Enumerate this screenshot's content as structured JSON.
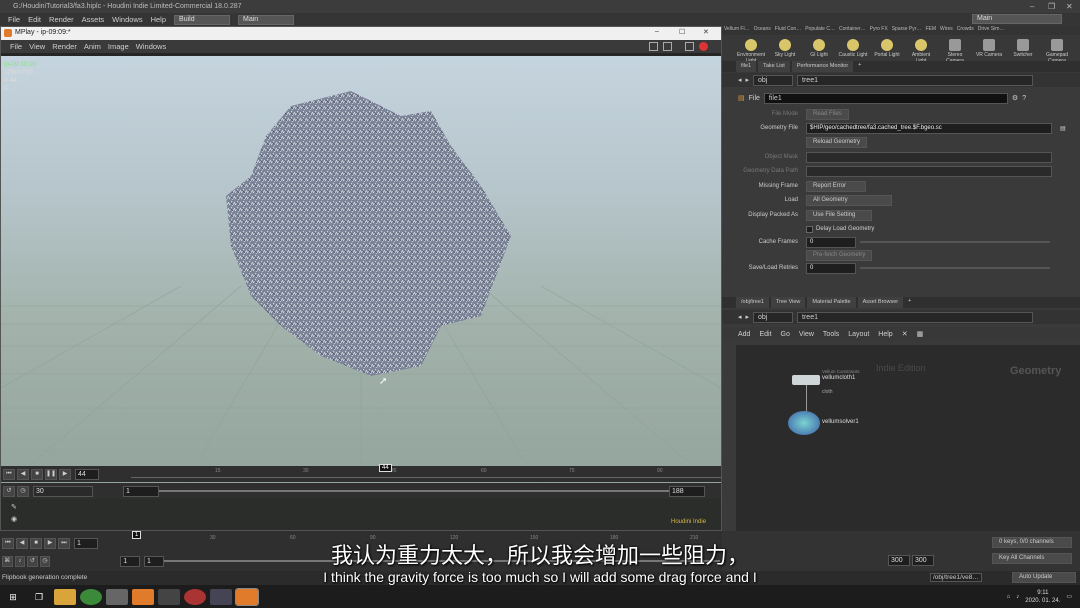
{
  "window_title": "G:/HoudiniTutorial3/fa3.hiplc - Houdini Indie Limited-Commercial 18.0.287",
  "app_menu": [
    "File",
    "Edit",
    "Render",
    "Assets",
    "Windows",
    "Help"
  ],
  "desktop_dropdown": "Build",
  "main_dropdown": "Main",
  "right_desktop": "Main",
  "mplay": {
    "title": "MPlay - ip-09:09:*",
    "menu": [
      "File",
      "View",
      "Render",
      "Anim",
      "Image",
      "Windows"
    ],
    "info": {
      "frame": "ip-09:10:20",
      "res": "1280x720",
      "fr": "fr 44",
      "c": "C"
    },
    "current_frame": "44",
    "start": "30",
    "range_start": "1",
    "range_end": "188",
    "ticks": [
      "15",
      "30",
      "45",
      "60",
      "75",
      "90"
    ],
    "marker": "44",
    "watermark": "Houdini Indie"
  },
  "shelf_tabs": [
    "Vellum Fl…",
    "Oceans",
    "Fluid Con…",
    "Populate C…",
    "Container…",
    "Pyro FX",
    "Sparse Pyr…",
    "FEM",
    "Wires",
    "Crowds",
    "Drive Sim…"
  ],
  "shelf_tools": [
    "Environment Light",
    "Sky Light",
    "GI Light",
    "Caustic Light",
    "Portal Light",
    "Ambient Light",
    "Stereo Camera",
    "VR Camera",
    "Switcher",
    "Gamepad Camera"
  ],
  "param_tabs": [
    "file1",
    "Take List",
    "Performance Monitor"
  ],
  "path": {
    "context": "obj",
    "node": "tree1"
  },
  "node_header": {
    "type": "File",
    "name": "file1"
  },
  "params": [
    {
      "label": "File Mode",
      "value": "Read Files",
      "dim": true
    },
    {
      "label": "Geometry File",
      "value": "$HIP/geo/cachedtree/fa3.cached_tree.$F.bgeo.sc"
    },
    {
      "label": "",
      "button": "Reload Geometry"
    },
    {
      "label": "Object Mask",
      "value": "",
      "dim": true
    },
    {
      "label": "Geometry Data Path",
      "value": "",
      "dim": true
    },
    {
      "label": "Missing Frame",
      "value": "Report Error"
    },
    {
      "label": "Load",
      "value": "All Geometry"
    },
    {
      "label": "Display Packed As",
      "value": "Use File Setting"
    },
    {
      "label": "",
      "check": "Delay Load Geometry"
    },
    {
      "label": "Cache Frames",
      "value": "0"
    },
    {
      "label": "",
      "button": "Pre-fetch Geometry"
    },
    {
      "label": "Save/Load Retries",
      "value": "0"
    }
  ],
  "net_tabs": [
    "/obj/tree1",
    "Tree View",
    "Material Palette",
    "Asset Browser"
  ],
  "net_menu": [
    "Add",
    "Edit",
    "Go",
    "View",
    "Tools",
    "Layout",
    "Help"
  ],
  "net_watermark": {
    "edition": "Indie Edition",
    "context": "Geometry"
  },
  "nodes": [
    {
      "name": "vellumcloth1",
      "sub": "Vellum Constraints",
      "flag": "cloth"
    },
    {
      "name": "vellumsolver1",
      "sub": "",
      "flag": ""
    }
  ],
  "main_timeline": {
    "ticks": [
      "1",
      "30",
      "60",
      "90",
      "120",
      "150",
      "180",
      "210",
      "240",
      "270"
    ],
    "frame": "1",
    "start": "1",
    "start2": "1",
    "end": "300",
    "end2": "300",
    "keys": "0 keys, 0/0 channels",
    "key_all": "Key All Channels",
    "marker": "1"
  },
  "status": {
    "text": "Flipbook generation complete",
    "path": "/obj/tree1/ve8…",
    "update": "Auto Update"
  },
  "subtitle_zh": "我认为重力太大，所以我会增加一些阻力，",
  "subtitle_en": "I think the gravity force is too much so I will add some drag force and I",
  "clock": {
    "time": "9:11",
    "date": "2020. 01. 24."
  },
  "colors": {
    "accent": "#d8b648",
    "frame_green": "#8be08b",
    "shelf_icon": "#d9c56a"
  }
}
